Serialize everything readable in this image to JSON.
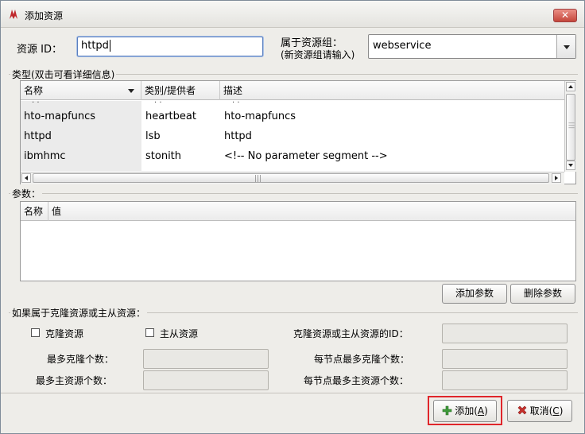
{
  "window": {
    "title": "添加资源",
    "close_label": "✕"
  },
  "resource": {
    "id_label": "资源 ID：",
    "id_value": "httpd",
    "group_label_line1": "属于资源组：",
    "group_label_line2": "(新资源组请输入)",
    "group_value": "webservice"
  },
  "types": {
    "section_label": "类型(双击可看详细信息)",
    "columns": [
      "名称",
      "类别/提供者",
      "描述"
    ],
    "rows": [
      {
        "name": "hto-mapfuncs",
        "provider": "heartbeat",
        "desc": "hto-mapfuncs"
      },
      {
        "name": "httpd",
        "provider": "lsb",
        "desc": "httpd"
      },
      {
        "name": "ibmhmc",
        "provider": "stonith",
        "desc": "<!-- No parameter segment -->"
      }
    ]
  },
  "params": {
    "section_label": "参数：",
    "columns": [
      "名称",
      "值"
    ],
    "add_button": "添加参数",
    "delete_button": "删除参数"
  },
  "clone": {
    "section_label": "如果属于克隆资源或主从资源：",
    "clone_checkbox_label": "克隆资源",
    "master_checkbox_label": "主从资源",
    "clone_id_label": "克隆资源或主从资源的ID：",
    "max_clones_label": "最多克隆个数：",
    "max_masters_label": "最多主资源个数：",
    "max_clones_per_node_label": "每节点最多克隆个数：",
    "max_masters_per_node_label": "每节点最多主资源个数："
  },
  "actions": {
    "add_label": "添加(",
    "add_mnemonic": "A",
    "cancel_label": "取消(",
    "cancel_mnemonic": "C",
    "close_paren": ")"
  },
  "colors": {
    "highlight": "#e0262b",
    "accent": "#5a7fbf"
  }
}
